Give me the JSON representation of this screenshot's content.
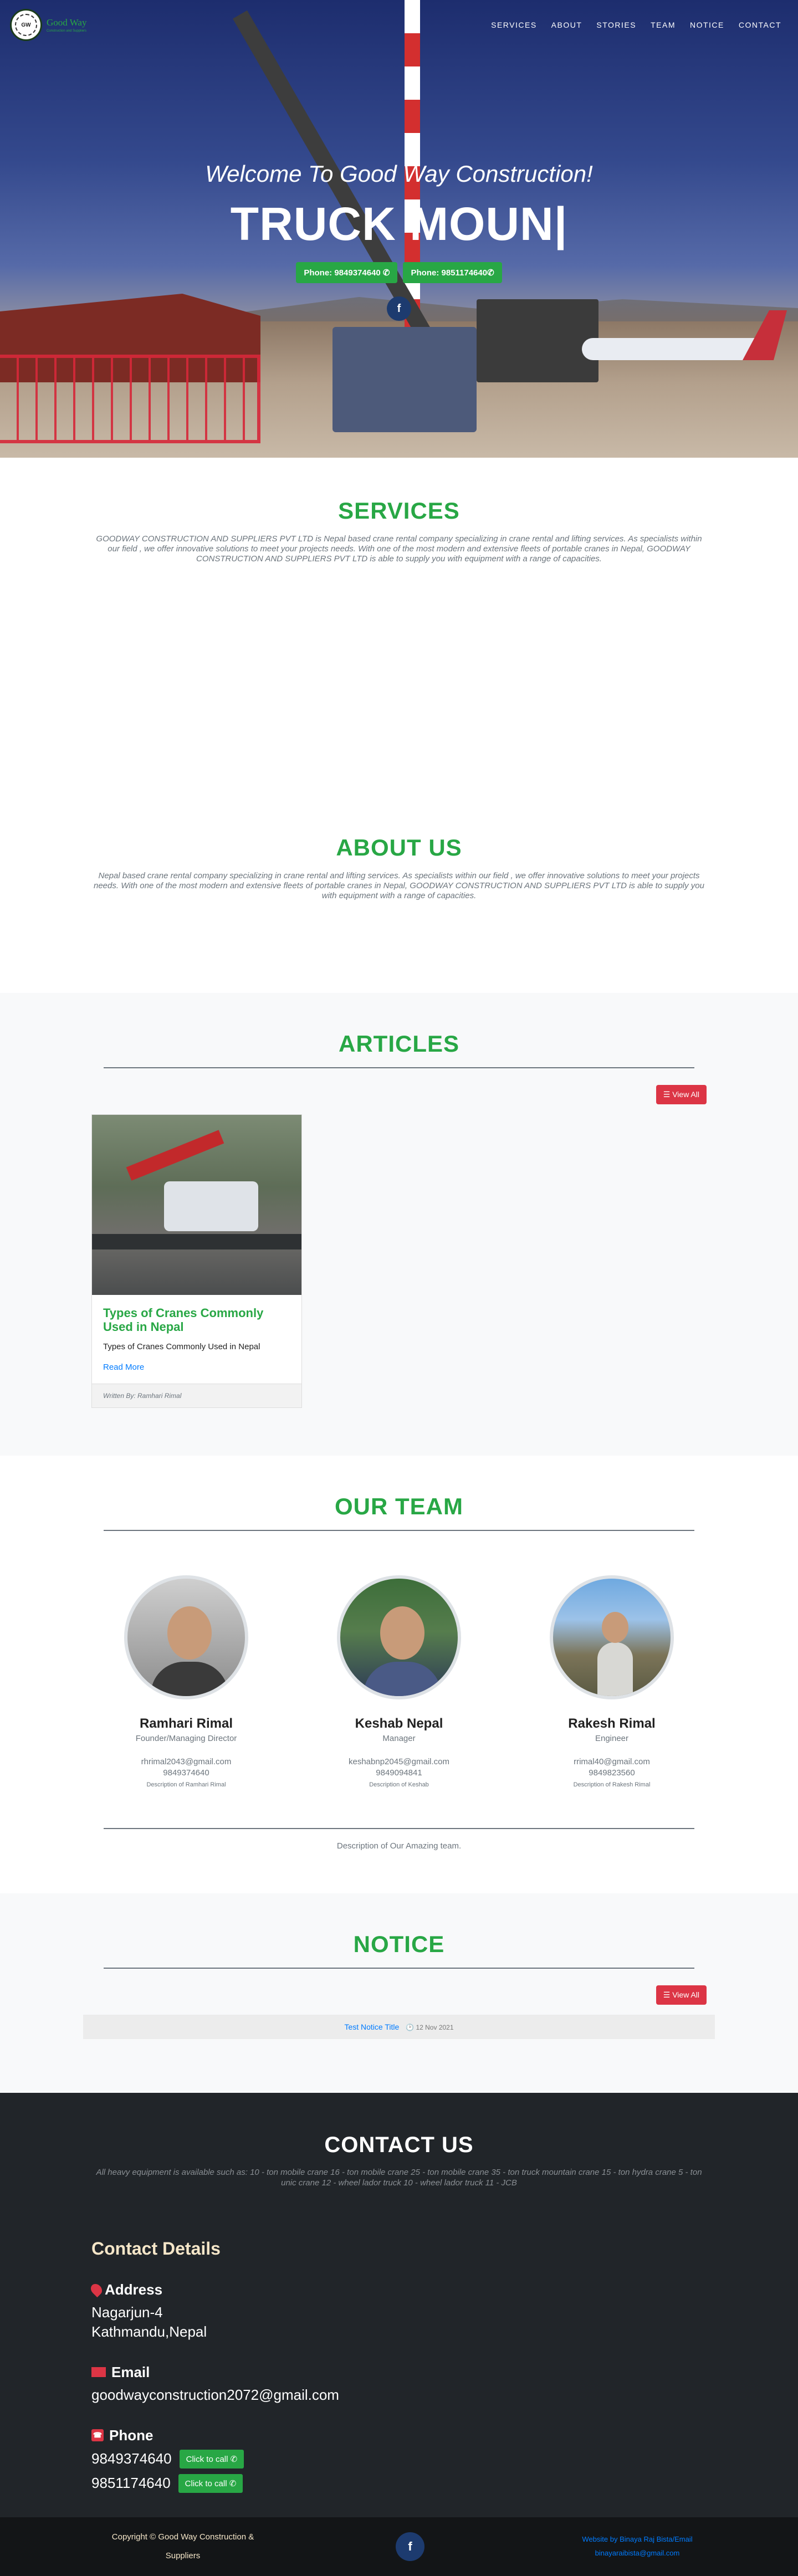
{
  "nav": {
    "brand_name": "Good Way",
    "brand_sub": "Construction and Suppliers",
    "logo_text": "GW",
    "links": [
      "SERVICES",
      "ABOUT",
      "STORIES",
      "TEAM",
      "NOTICE",
      "CONTACT"
    ]
  },
  "hero": {
    "welcome": "Welcome To Good Way Construction!",
    "typed": "TRUCK MOUN|",
    "phones": [
      "Phone: 9849374640 ✆",
      "Phone: 9851174640✆"
    ],
    "fb_icon": "facebook-icon",
    "fb_glyph": "f"
  },
  "services": {
    "title": "SERVICES",
    "text": "GOODWAY CONSTRUCTION AND SUPPLIERS PVT LTD is Nepal based crane rental company specializing in crane rental and lifting services. As specialists within our field , we offer innovative solutions to meet your projects needs. With one of the most modern and extensive fleets of portable cranes in Nepal, GOODWAY CONSTRUCTION AND SUPPLIERS PVT LTD is able to supply you with equipment with a range of capacities."
  },
  "about": {
    "title": "ABOUT US",
    "text": "Nepal based crane rental company specializing in crane rental and lifting services. As specialists within our field , we offer innovative solutions to meet your projects needs. With one of the most modern and extensive fleets of portable cranes in Nepal, GOODWAY CONSTRUCTION AND SUPPLIERS PVT LTD is able to supply you with equipment with a range of capacities."
  },
  "articles": {
    "title": "ARTICLES",
    "view_all": "☰ View All",
    "card": {
      "title": "Types of Cranes Commonly Used in Nepal",
      "text": "Types of Cranes Commonly Used in Nepal",
      "link": "Read More",
      "footer": "Written By: Ramhari Rimal"
    }
  },
  "team": {
    "title": "OUR TEAM",
    "members": [
      {
        "name": "Ramhari Rimal",
        "role": "Founder/Managing Director",
        "email": "rhrimal2043@gmail.com",
        "phone": "9849374640",
        "desc": "Description of Ramhari Rimal"
      },
      {
        "name": "Keshab Nepal",
        "role": "Manager",
        "email": "keshabnp2045@gmail.com",
        "phone": "9849094841",
        "desc": "Description of Keshab"
      },
      {
        "name": "Rakesh Rimal",
        "role": "Engineer",
        "email": "rrimal40@gmail.com",
        "phone": "9849823560",
        "desc": "Description of Rakesh Rimal"
      }
    ],
    "description": "Description of Our Amazing team."
  },
  "notice": {
    "title": "NOTICE",
    "view_all": "☰ View All",
    "item_title": "Test Notice Title",
    "item_date": "🕑 12 Nov 2021"
  },
  "contact": {
    "title": "CONTACT US",
    "lead": "All heavy equipment is available such as: 10 - ton mobile crane 16 - ton mobile crane 25 - ton mobile crane 35 - ton truck mountain crane 15 - ton hydra crane 5 - ton unic crane 12 - wheel lador truck 10 - wheel lador truck 11 - JCB",
    "details_title": "Contact Details",
    "address_label": "Address",
    "address_line1": "Nagarjun-4",
    "address_line2": "Kathmandu,Nepal",
    "email_label": "Email",
    "email": "goodwayconstruction2072@gmail.com",
    "phone_label": "Phone",
    "phones": [
      "9849374640",
      "9851174640"
    ],
    "call_label": "Click to call ✆"
  },
  "footer": {
    "copyright_line1": "Copyright © Good Way Construction &",
    "copyright_line2": "Suppliers",
    "fb_glyph": "f",
    "credit_line1": "Website by Binaya Raj Bista/Email",
    "credit_line2": "binayaraibista@gmail.com"
  },
  "colors": {
    "accent_green": "#28a745",
    "accent_red": "#dc3545",
    "link_blue": "#007bff",
    "dark": "#212529"
  }
}
